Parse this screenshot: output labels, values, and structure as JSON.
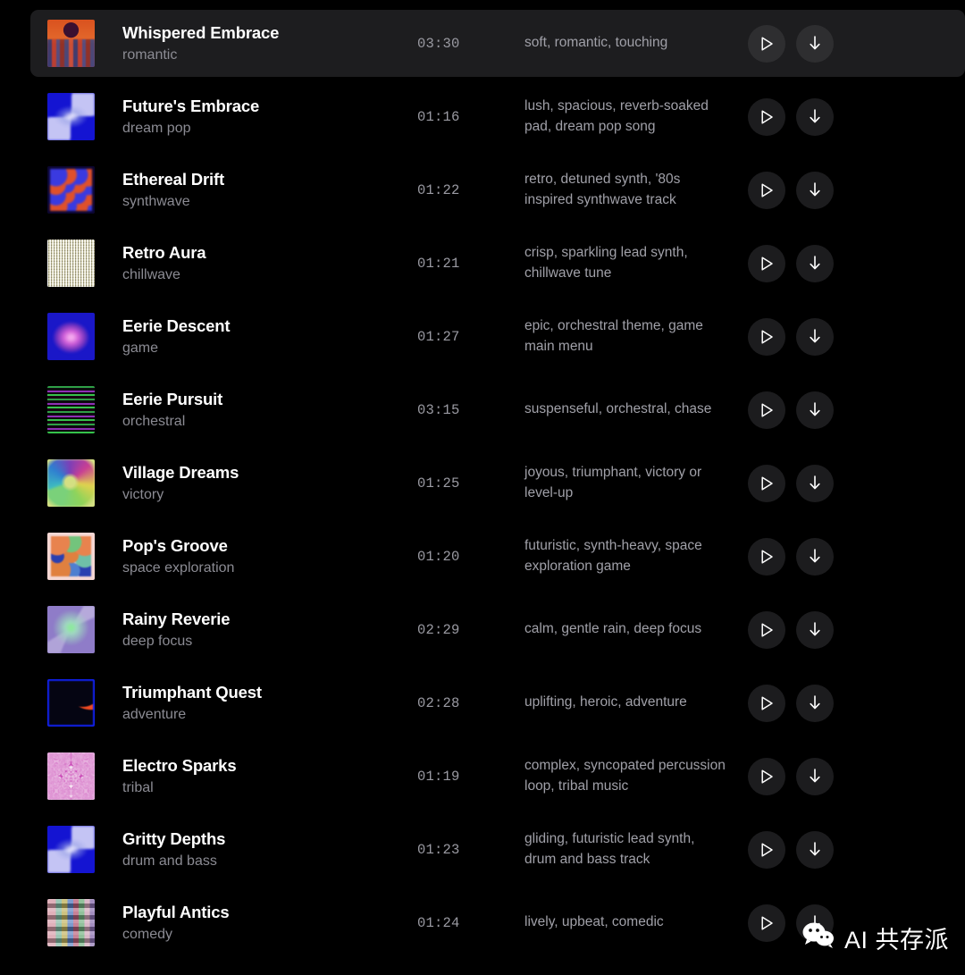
{
  "app": {
    "view_name": "music-track-list",
    "colors": {
      "background": "#000000",
      "active_row": "#1d1d1f",
      "title_text": "#ffffff",
      "genre_text": "#8b8b93",
      "duration_text": "#9a9aa2",
      "description_text": "#a0a0a8",
      "button_background": "#1c1c1e"
    }
  },
  "actions": {
    "play_label": "Play",
    "play_icon": "play-triangle-outline-icon",
    "download_label": "Download",
    "download_icon": "arrow-down-icon"
  },
  "watermark": {
    "icon": "wechat-logo-icon",
    "text": "AI 共存派"
  },
  "tracks": [
    {
      "title": "Whispered Embrace",
      "genre": "romantic",
      "duration": "03:30",
      "description": "soft, romantic, touching",
      "active": true,
      "art": "art-crowd"
    },
    {
      "title": "Future's Embrace",
      "genre": "dream pop",
      "duration": "01:16",
      "description": "lush, spacious, reverb-soaked pad, dream pop song",
      "active": false,
      "art": "art-xblue"
    },
    {
      "title": "Ethereal Drift",
      "genre": "synthwave",
      "duration": "01:22",
      "description": "retro, detuned synth, '80s inspired synthwave track",
      "active": false,
      "art": "art-dots"
    },
    {
      "title": "Retro Aura",
      "genre": "chillwave",
      "duration": "01:21",
      "description": "crisp, sparkling lead synth, chillwave tune",
      "active": false,
      "art": "art-weave"
    },
    {
      "title": "Eerie Descent",
      "genre": "game",
      "duration": "01:27",
      "description": "epic, orchestral theme, game main menu",
      "active": false,
      "art": "art-pinkdiamond"
    },
    {
      "title": "Eerie Pursuit",
      "genre": "orchestral",
      "duration": "03:15",
      "description": "suspenseful, orchestral, chase",
      "active": false,
      "art": "art-stripes"
    },
    {
      "title": "Village Dreams",
      "genre": "victory",
      "duration": "01:25",
      "description": "joyous, triumphant, victory or level-up",
      "active": false,
      "art": "art-swirl"
    },
    {
      "title": "Pop's Groove",
      "genre": "space exploration",
      "duration": "01:20",
      "description": "futuristic, synth-heavy, space exploration game",
      "active": false,
      "art": "art-pinkdots"
    },
    {
      "title": "Rainy Reverie",
      "genre": "deep focus",
      "duration": "02:29",
      "description": "calm, gentle rain, deep focus",
      "active": false,
      "art": "art-greenglow"
    },
    {
      "title": "Triumphant Quest",
      "genre": "adventure",
      "duration": "02:28",
      "description": "uplifting, heroic, adventure",
      "active": false,
      "art": "art-bluegrid"
    },
    {
      "title": "Electro Sparks",
      "genre": "tribal",
      "duration": "01:19",
      "description": "complex, syncopated percussion loop, tribal music",
      "active": false,
      "art": "art-rays"
    },
    {
      "title": "Gritty Depths",
      "genre": "drum and bass",
      "duration": "01:23",
      "description": "gliding, futuristic lead synth, drum and bass track",
      "active": false,
      "art": "art-xblue"
    },
    {
      "title": "Playful Antics",
      "genre": "comedy",
      "duration": "01:24",
      "description": "lively, upbeat, comedic",
      "active": false,
      "art": "art-mosaic"
    }
  ]
}
